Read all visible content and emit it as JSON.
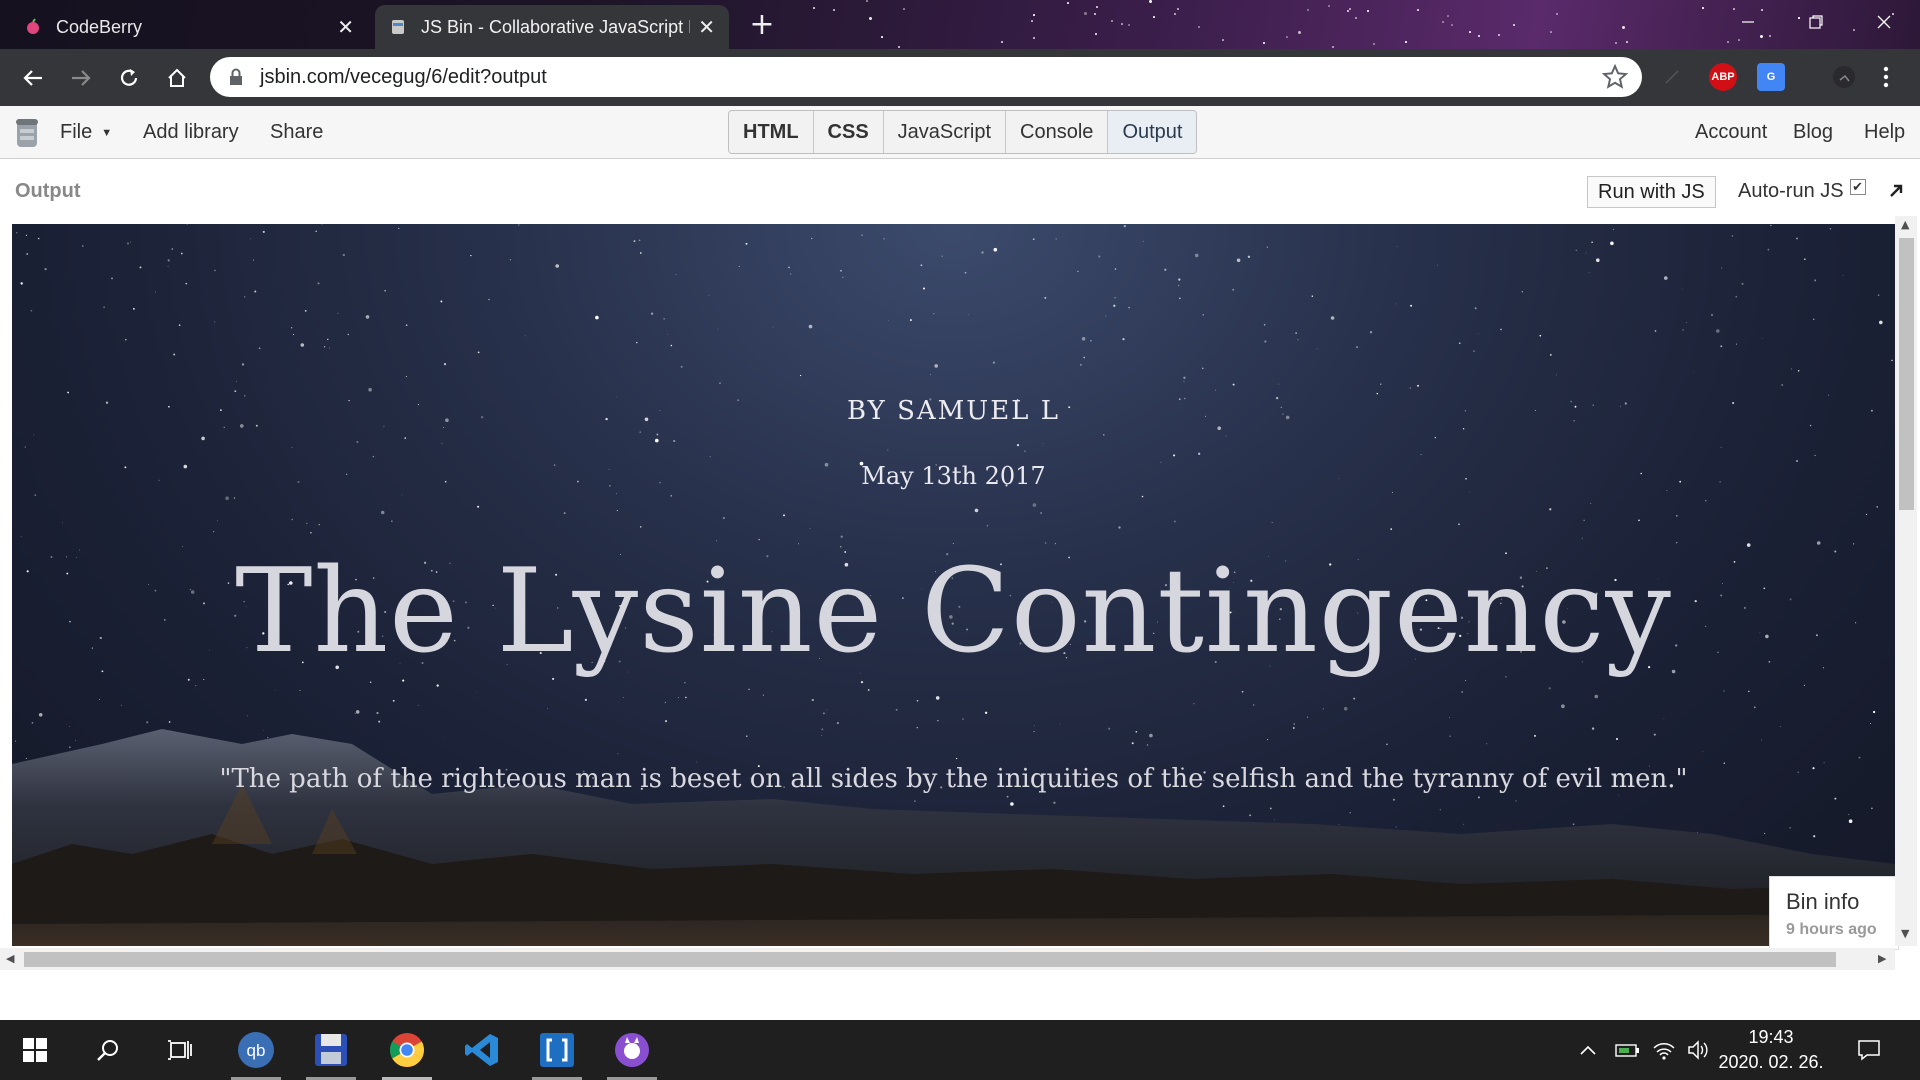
{
  "browser": {
    "tabs": [
      {
        "title": "CodeBerry",
        "active": false
      },
      {
        "title": "JS Bin - Collaborative JavaScript Debugging",
        "active": true
      }
    ],
    "url": "jsbin.com/vecegug/6/edit?output",
    "extensions": [
      {
        "name": "adblock-plus-icon",
        "label": "ABP",
        "color": "#d10f15"
      },
      {
        "name": "google-translate-icon",
        "label": "G",
        "color": "#4285f4"
      }
    ]
  },
  "jsbin": {
    "menu": {
      "file": "File",
      "add_library": "Add library",
      "share": "Share"
    },
    "panels": [
      {
        "label": "HTML",
        "bold": true
      },
      {
        "label": "CSS",
        "bold": true
      },
      {
        "label": "JavaScript",
        "bold": false
      },
      {
        "label": "Console",
        "bold": false
      },
      {
        "label": "Output",
        "bold": false,
        "active": true
      }
    ],
    "right_menu": {
      "account": "Account",
      "blog": "Blog",
      "help": "Help"
    },
    "output_label": "Output",
    "run_button": "Run with JS",
    "auto_run_label": "Auto-run JS",
    "auto_run_checked": true
  },
  "page": {
    "byline": "BY SAMUEL L",
    "date": "May 13th 2017",
    "headline": "The Lysine Contingency",
    "quote": "\"The path of the righteous man is beset on all sides by the iniquities of the selfish and the tyranny of evil men.\""
  },
  "bin_info": {
    "title": "Bin info",
    "subtitle": "9 hours ago"
  },
  "taskbar": {
    "apps": [
      {
        "name": "search-icon"
      },
      {
        "name": "task-view-icon"
      },
      {
        "name": "qbittorrent-icon",
        "label": "qb"
      },
      {
        "name": "save-app-icon"
      },
      {
        "name": "chrome-icon"
      },
      {
        "name": "vscode-icon"
      },
      {
        "name": "bracket-app-icon"
      },
      {
        "name": "github-desktop-icon"
      }
    ],
    "time": "19:43",
    "date": "2020. 02. 26."
  },
  "colors": {
    "chrome_dark": "#35363a",
    "jsbin_bar": "#f6f6f6",
    "taskbar": "#1f1f1f"
  }
}
